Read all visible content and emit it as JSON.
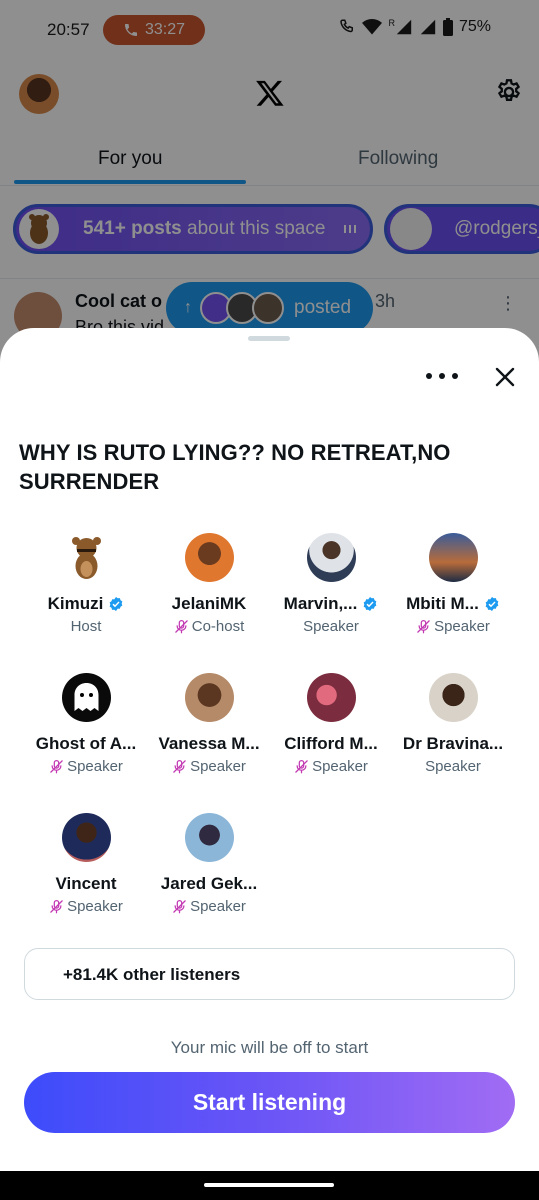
{
  "status_bar": {
    "time": "20:57",
    "call_timer": "33:27",
    "network": "R",
    "battery": "75%"
  },
  "header": {
    "logo": "X",
    "settings_icon": "gear-icon"
  },
  "tabs": [
    {
      "label": "For you",
      "active": true
    },
    {
      "label": "Following",
      "active": false
    }
  ],
  "space_pill": {
    "count": "541+ posts",
    "suffix": "about this space"
  },
  "handle_pill": {
    "label": "@rodgers_"
  },
  "tweet": {
    "name": "Cool cat o",
    "handle_tail": "s_ · 3h",
    "body": "Bro this vid"
  },
  "posted_pill": {
    "label": "posted"
  },
  "sheet": {
    "title": "WHY IS RUTO LYING?? NO RETREAT,NO SURRENDER",
    "participants": [
      {
        "name": "Kimuzi",
        "role": "Host",
        "verified": true,
        "muted": false
      },
      {
        "name": "JelaniMK",
        "role": "Co-host",
        "verified": false,
        "muted": true
      },
      {
        "name": "Marvin,...",
        "role": "Speaker",
        "verified": true,
        "muted": false
      },
      {
        "name": "Mbiti M...",
        "role": "Speaker",
        "verified": true,
        "muted": true
      },
      {
        "name": "Ghost of A...",
        "role": "Speaker",
        "verified": false,
        "muted": true
      },
      {
        "name": "Vanessa M...",
        "role": "Speaker",
        "verified": false,
        "muted": true
      },
      {
        "name": "Clifford M...",
        "role": "Speaker",
        "verified": false,
        "muted": true
      },
      {
        "name": "Dr Bravina...",
        "role": "Speaker",
        "verified": false,
        "muted": false
      },
      {
        "name": "Vincent",
        "role": "Speaker",
        "verified": false,
        "muted": true
      },
      {
        "name": "Jared Gek...",
        "role": "Speaker",
        "verified": false,
        "muted": true
      }
    ],
    "listeners": "+81.4K other listeners",
    "mic_note": "Your mic will be off to start",
    "start_button": "Start listening"
  },
  "colors": {
    "accent": "#1d9bf0",
    "button_start": "#3d4cfb",
    "button_end": "#a16cf4",
    "call_pill": "#c9562f",
    "mic_off": "#c239b3"
  }
}
